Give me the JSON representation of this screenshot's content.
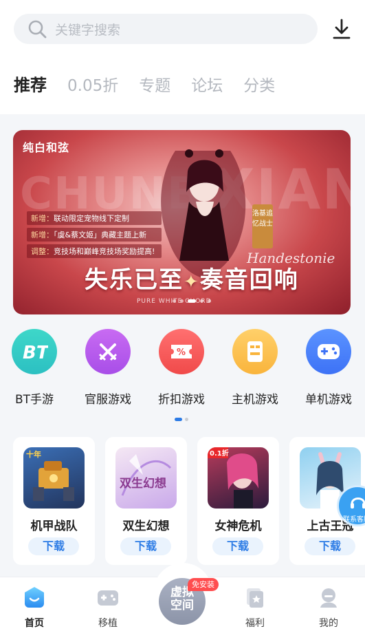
{
  "search": {
    "placeholder": "关键字搜索"
  },
  "tabs": [
    {
      "label": "推荐",
      "active": true
    },
    {
      "label": "0.05折"
    },
    {
      "label": "专题"
    },
    {
      "label": "论坛"
    },
    {
      "label": "分类"
    }
  ],
  "banner": {
    "logo": "纯白和弦",
    "notes": [
      {
        "tag": "新增：",
        "text": "联动限定宠物线下定制"
      },
      {
        "tag": "新增：",
        "text": "「虞&蔡文姬」典藏主题上新"
      },
      {
        "tag": "调整：",
        "text": "竞技场和巅峰竞技场奖励提高!"
      }
    ],
    "headline_left": "失乐已至",
    "headline_right": "奏音回响",
    "script": "Handestonie",
    "seal": "洛基追忆战士",
    "sub": "PURE WHITE CHORD"
  },
  "categories": [
    {
      "label": "BT手游",
      "color_a": "#3ed7c9",
      "color_b": "#2cc0c2",
      "icon": "bt-icon"
    },
    {
      "label": "官服游戏",
      "color_a": "#c86bf2",
      "color_b": "#a84ee8",
      "icon": "swords-icon"
    },
    {
      "label": "折扣游戏",
      "color_a": "#ff7070",
      "color_b": "#f04a4a",
      "icon": "coupon-icon"
    },
    {
      "label": "主机游戏",
      "color_a": "#ffd06a",
      "color_b": "#f9b43c",
      "icon": "console-icon"
    },
    {
      "label": "单机游戏",
      "color_a": "#5b93ff",
      "color_b": "#3d72f6",
      "icon": "gamepad-icon"
    }
  ],
  "games": [
    {
      "name": "机甲战队",
      "action": "下载",
      "badge": "十年",
      "colors": [
        "#3b6fb6",
        "#22345c"
      ]
    },
    {
      "name": "双生幻想",
      "action": "下载",
      "colors": [
        "#f5e8f4",
        "#c9a9ea"
      ]
    },
    {
      "name": "女神危机",
      "action": "下载",
      "badge": "0.1折",
      "colors": [
        "#b73b5b",
        "#2b1b3c"
      ]
    },
    {
      "name": "上古王冠",
      "action": "下载",
      "colors": [
        "#8fd0f0",
        "#e7f3fb"
      ]
    }
  ],
  "float_service": "联系客服",
  "bottom_nav": [
    {
      "label": "首页",
      "active": true
    },
    {
      "label": "移植"
    },
    {
      "label": "福利"
    },
    {
      "label": "我的"
    }
  ],
  "center": {
    "line1": "虚拟",
    "line2": "空间",
    "badge": "免安装"
  },
  "accent": "#2c7be5"
}
